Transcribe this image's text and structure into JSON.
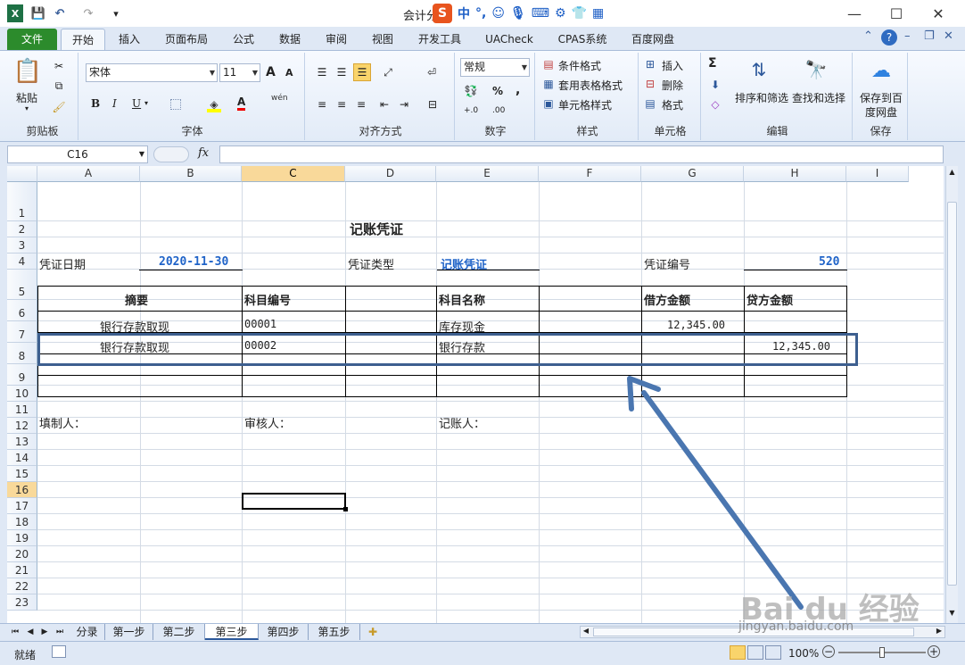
{
  "window": {
    "title": "会计分",
    "ime": {
      "logo": "S",
      "mode": "中",
      "punct": "°,"
    },
    "controls": {
      "minimize": "—",
      "maximize": "☐",
      "close": "✕"
    }
  },
  "quick_access": {
    "save": "💾",
    "undo": "↶",
    "redo": "↷",
    "customize": "▾"
  },
  "tabs": [
    "文件",
    "开始",
    "插入",
    "页面布局",
    "公式",
    "数据",
    "审阅",
    "视图",
    "开发工具",
    "UACheck",
    "CPAS系统",
    "百度网盘"
  ],
  "active_tab": "开始",
  "ribbon": {
    "clipboard": {
      "paste": "粘贴",
      "label": "剪贴板"
    },
    "font": {
      "name": "宋体",
      "size": "11",
      "grow": "A",
      "shrink": "A",
      "bold": "B",
      "italic": "I",
      "underline": "U",
      "color_letter": "A",
      "phonetic": "wén",
      "label": "字体"
    },
    "alignment": {
      "label": "对齐方式"
    },
    "number": {
      "format": "常规",
      "percent": "%",
      "comma": ",",
      "inc": "+.0",
      "dec": ".00",
      "label": "数字"
    },
    "styles": {
      "conditional": "条件格式",
      "table": "套用表格格式",
      "cell": "单元格样式",
      "label": "样式"
    },
    "cells": {
      "insert": "插入",
      "delete": "删除",
      "format": "格式",
      "label": "单元格"
    },
    "editing": {
      "sum": "Σ",
      "sort": "排序和筛选",
      "find": "查找和选择",
      "label": "编辑"
    },
    "save": {
      "line1": "保存到百",
      "line2": "度网盘",
      "label": "保存"
    }
  },
  "formula_bar": {
    "name_box": "C16",
    "fx": "fx",
    "value": ""
  },
  "columns": [
    "A",
    "B",
    "C",
    "D",
    "E",
    "F",
    "G",
    "H",
    "I"
  ],
  "rows": [
    "1",
    "2",
    "3",
    "4",
    "5",
    "6",
    "7",
    "8",
    "9",
    "10",
    "11",
    "12",
    "13",
    "14",
    "15",
    "16",
    "17",
    "18",
    "19",
    "20",
    "21",
    "22",
    "23"
  ],
  "selected_cell": "C16",
  "voucher": {
    "title": "记账凭证",
    "date_label": "凭证日期",
    "date_value": "2020-11-30",
    "type_label": "凭证类型",
    "type_value": "记账凭证",
    "number_label": "凭证编号",
    "number_value": "520",
    "headers": {
      "summary": "摘要",
      "code": "科目编号",
      "name": "科目名称",
      "debit": "借方金额",
      "credit": "贷方金额"
    },
    "lines": [
      {
        "summary": "银行存款取现",
        "code": "00001",
        "name": "库存现金",
        "debit": "12,345.00",
        "credit": ""
      },
      {
        "summary": "银行存款取现",
        "code": "00002",
        "name": "银行存款",
        "debit": "",
        "credit": "12,345.00"
      }
    ],
    "preparer": "填制人：",
    "reviewer": "审核人：",
    "bookkeeper": "记账人："
  },
  "sheets": [
    "分录",
    "第一步",
    "第二步",
    "第三步",
    "第四步",
    "第五步"
  ],
  "active_sheet": "第三步",
  "status": {
    "ready": "就绪",
    "zoom": "100%"
  },
  "watermark": {
    "brand": "Bai du 经验",
    "url": "jingyan.baidu.com"
  },
  "colors": {
    "file_tab": "#2c8b2c",
    "highlight_box": "#3d5f8f",
    "arrow": "#4a76b0",
    "blue_text": "#1f63c8"
  }
}
